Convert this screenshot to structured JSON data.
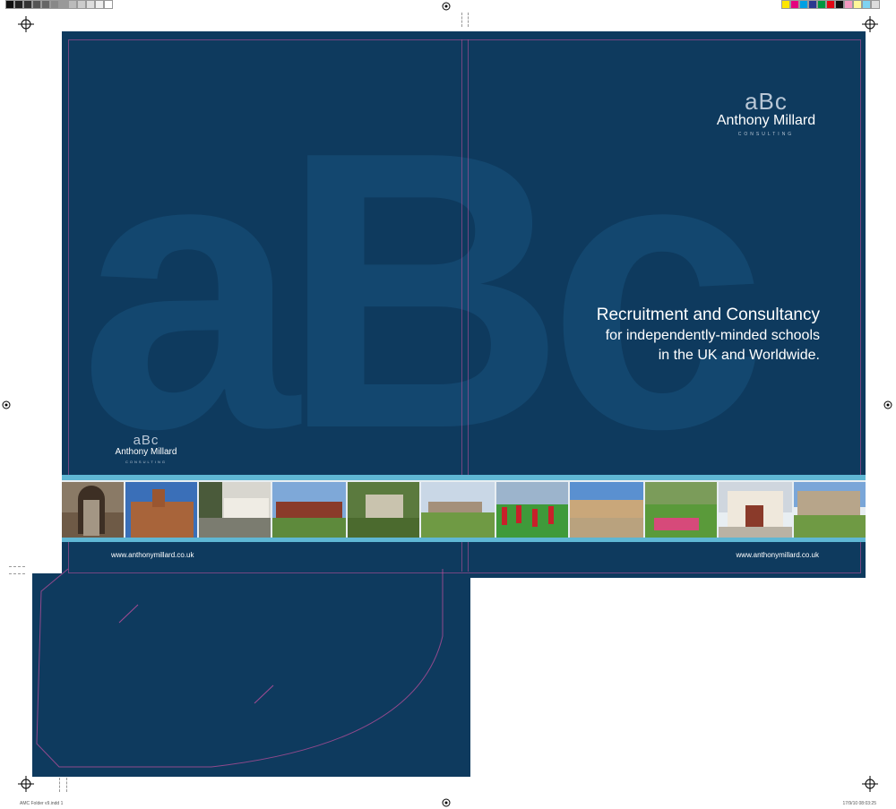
{
  "logo": {
    "mark": "aBc",
    "name": "Anthony Millard",
    "sub": "CONSULTING"
  },
  "headline": {
    "line1": "Recruitment and Consultancy",
    "line2": "for independently-minded schools",
    "line3": "in the UK and Worldwide."
  },
  "watermark": "aBc",
  "website_left": "www.anthonymillard.co.uk",
  "website_right": "www.anthonymillard.co.uk",
  "slug": {
    "left": "AMC Folder v9.indd  1",
    "right": "17/9/10  08:03:25"
  },
  "colors": {
    "navy": "#0e3a5e",
    "accent_teal": "#5fb7d4",
    "logo_grey": "#b9c7d6"
  },
  "photos": [
    {
      "name": "cloister-arch"
    },
    {
      "name": "brick-chapel"
    },
    {
      "name": "colonnade-palms"
    },
    {
      "name": "colonial-house"
    },
    {
      "name": "stone-cottage"
    },
    {
      "name": "school-grounds"
    },
    {
      "name": "students-field"
    },
    {
      "name": "stone-terrace"
    },
    {
      "name": "picnic-lawn"
    },
    {
      "name": "school-entrance"
    },
    {
      "name": "gothic-hall"
    }
  ]
}
